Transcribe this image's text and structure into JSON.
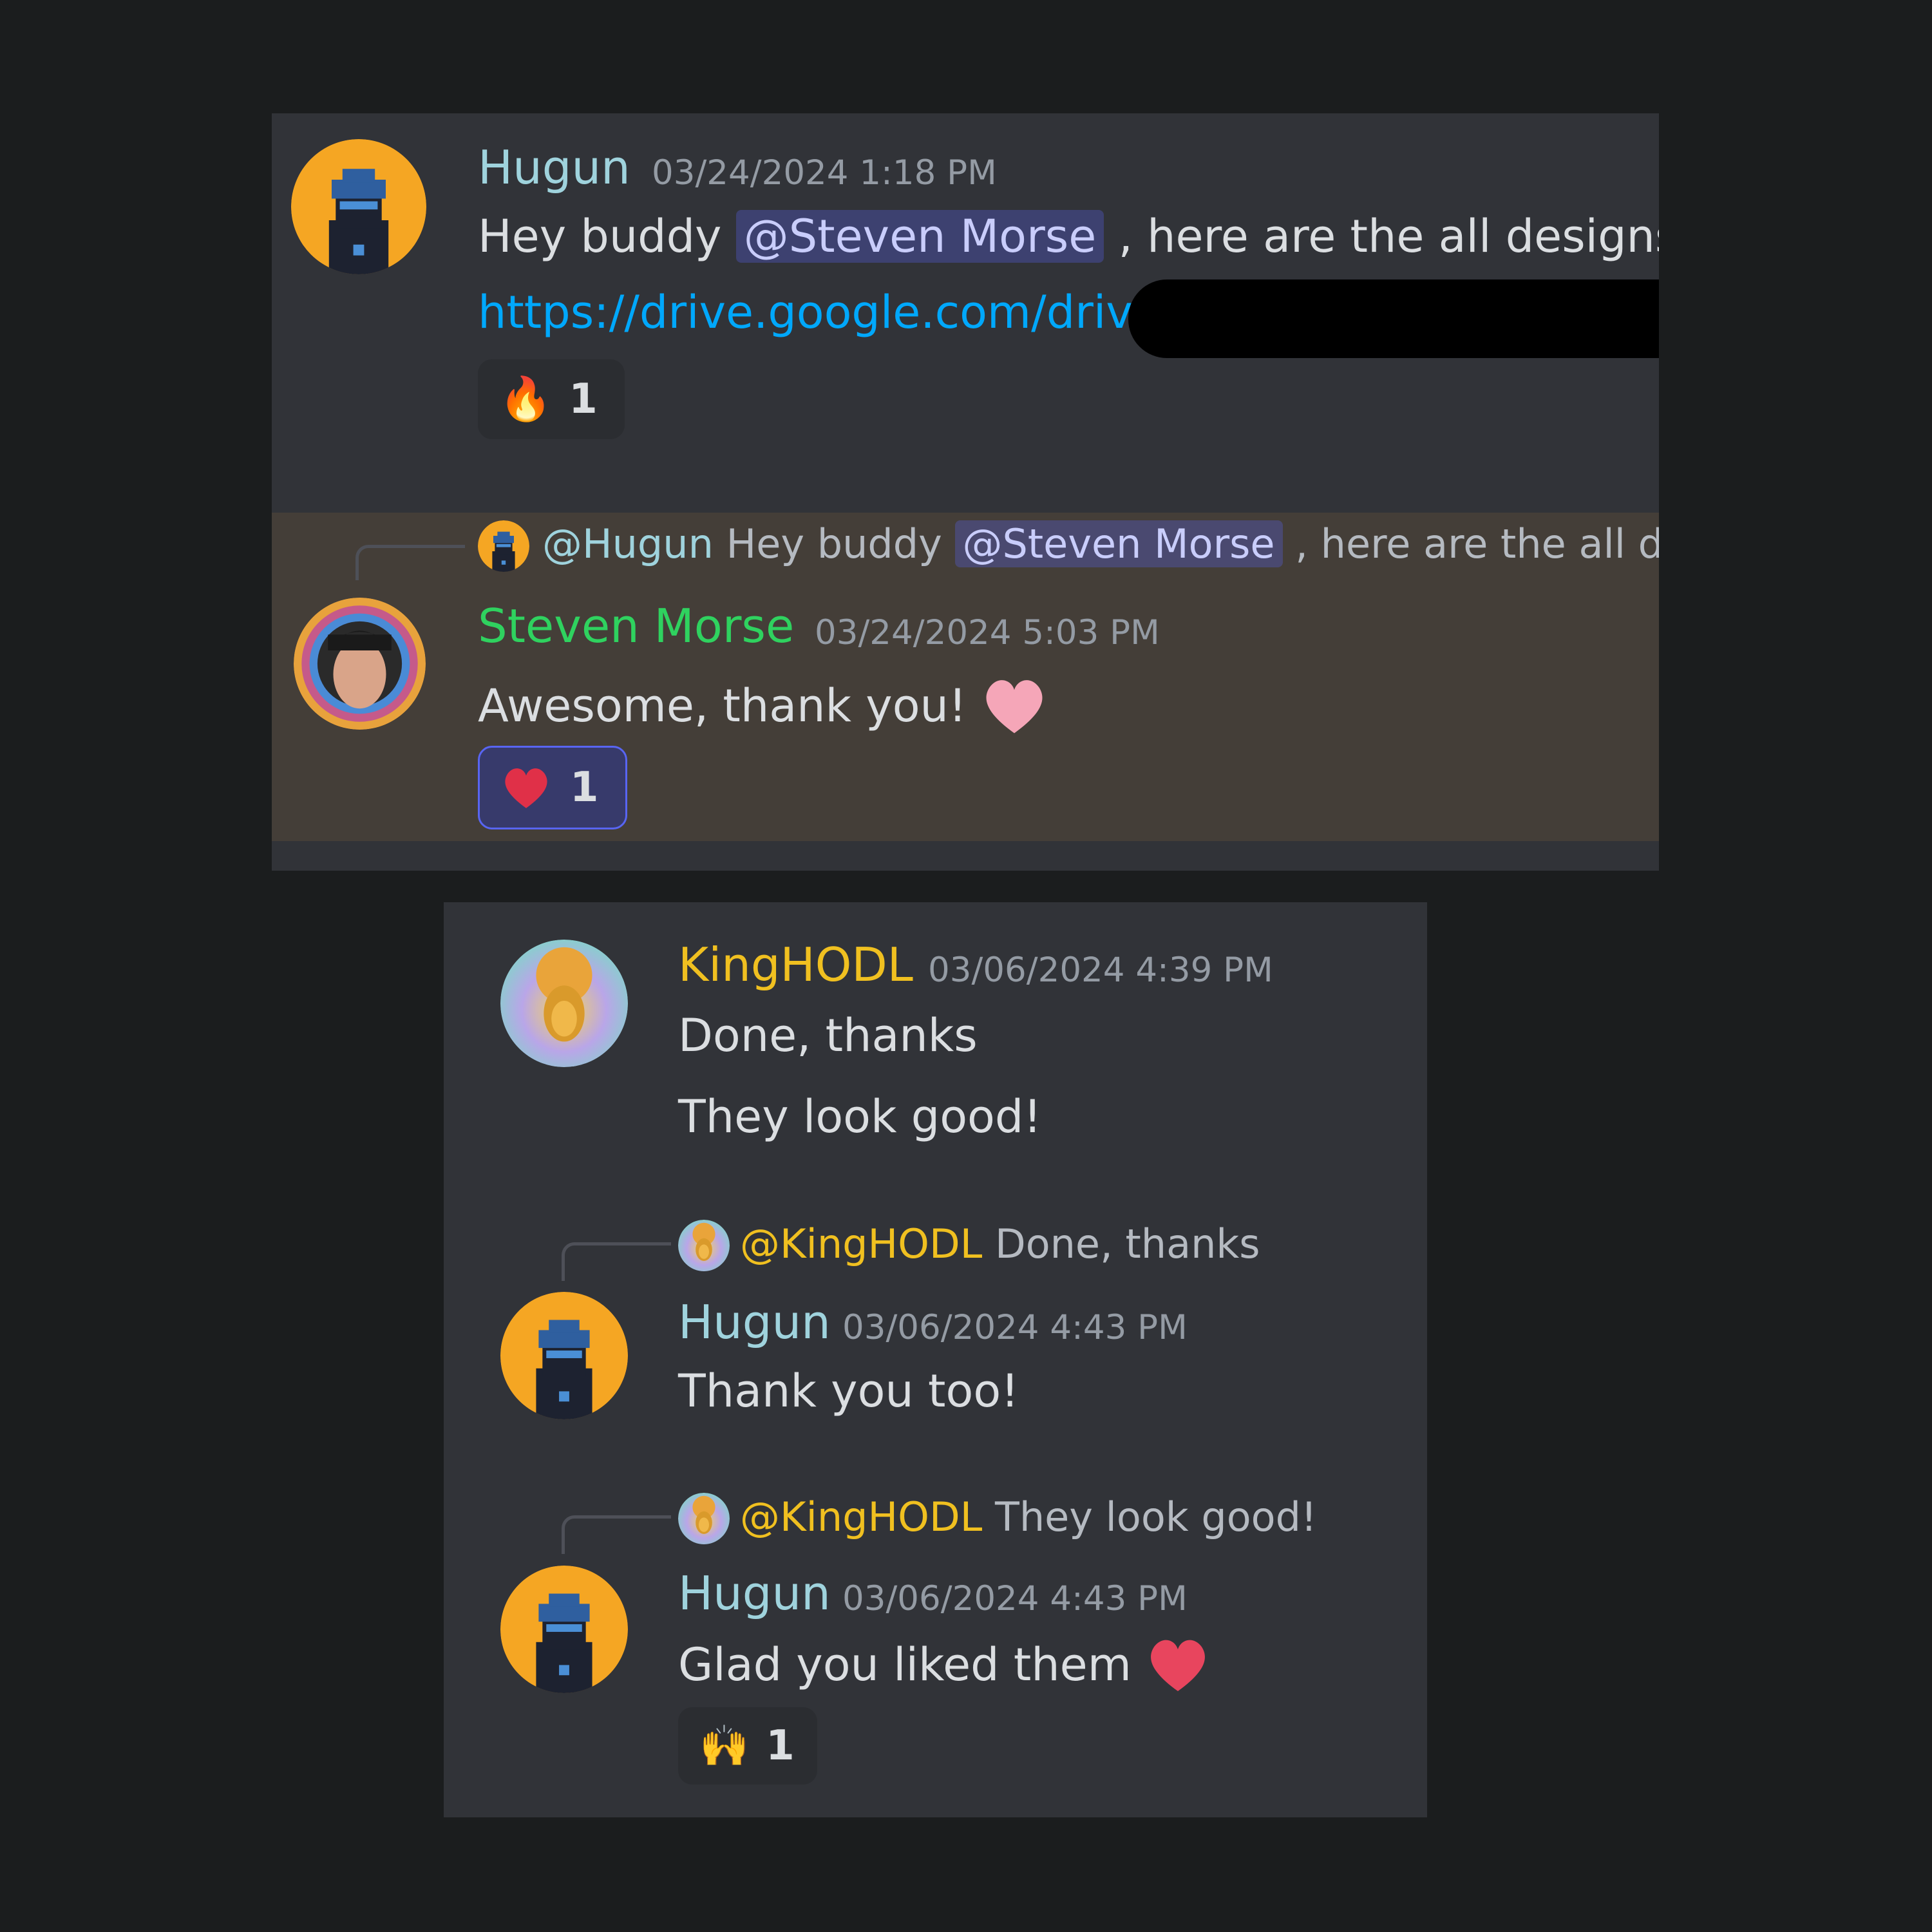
{
  "colors": {
    "page_background": "#1b1d1e",
    "panel_background": "#313338",
    "highlight_background": "#443e38",
    "hugun_name": "#9fd3dd",
    "steven_name": "#2fd25f",
    "kinghodl_name": "#f0c020",
    "timestamp": "#949ba4",
    "link": "#00a8fc",
    "mention_text": "#c9cdfb"
  },
  "top_panel": {
    "message_1": {
      "avatar_icon": "pixel-ninja-avatar",
      "username": "Hugun",
      "timestamp": "03/24/2024 1:18 PM",
      "text_before": "Hey buddy ",
      "mention": "@Steven Morse",
      "text_after": " , here are the all designs,",
      "link": "https://drive.google.com/driv",
      "reaction": {
        "emoji": "🔥",
        "emoji_name": "fire-emoji",
        "count": "1"
      }
    },
    "message_2": {
      "reply": {
        "avatar_icon": "pixel-ninja-avatar",
        "name": "@Hugun",
        "text_before": " Hey buddy ",
        "mention": "@Steven Morse",
        "text_after": " , here are the all de"
      },
      "avatar_icon": "portrait-avatar",
      "username": "Steven Morse",
      "timestamp": "03/24/2024 5:03 PM",
      "text": "Awesome, thank you!",
      "inline_emoji_name": "pink-heart-emoji",
      "reaction": {
        "emoji_name": "red-heart-emoji",
        "count": "1"
      }
    }
  },
  "bottom_panel": {
    "message_1": {
      "avatar_icon": "golden-face-avatar",
      "username": "KingHODL",
      "timestamp": "03/06/2024 4:39 PM",
      "line_1": "Done, thanks",
      "line_2": "They look good!"
    },
    "message_2": {
      "reply": {
        "avatar_icon": "golden-face-avatar",
        "name": "@KingHODL",
        "text": " Done, thanks"
      },
      "avatar_icon": "pixel-ninja-avatar",
      "username": "Hugun",
      "timestamp": "03/06/2024 4:43 PM",
      "text": "Thank you too!"
    },
    "message_3": {
      "reply": {
        "avatar_icon": "golden-face-avatar",
        "name": "@KingHODL",
        "text": " They look good!"
      },
      "avatar_icon": "pixel-ninja-avatar",
      "username": "Hugun",
      "timestamp": "03/06/2024 4:43 PM",
      "text": "Glad you liked them",
      "inline_emoji_name": "heart-emoji",
      "reaction": {
        "emoji": "🙌",
        "emoji_name": "raised-hands-emoji",
        "count": "1"
      }
    }
  }
}
